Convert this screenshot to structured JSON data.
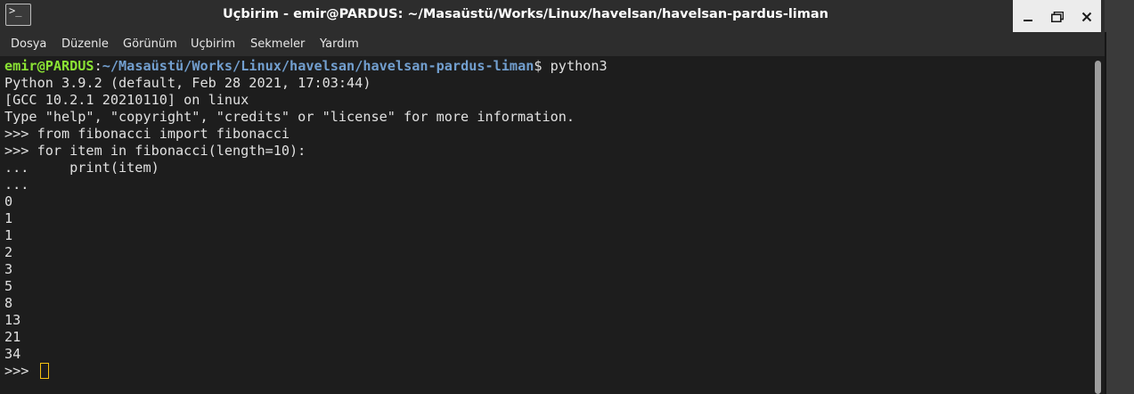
{
  "window": {
    "title": "Uçbirim - emir@PARDUS: ~/Masaüstü/Works/Linux/havelsan/havelsan-pardus-liman",
    "app_icon_glyph": ">_",
    "controls": {
      "minimize": "–",
      "maximize": "❐",
      "close": "✕"
    }
  },
  "menubar": {
    "items": [
      "Dosya",
      "Düzenle",
      "Görünüm",
      "Uçbirim",
      "Sekmeler",
      "Yardım"
    ]
  },
  "terminal": {
    "prompt_user": "emir@PARDUS",
    "prompt_sep": ":",
    "prompt_path": "~/Masaüstü/Works/Linux/havelsan/havelsan-pardus-liman",
    "prompt_command": "$ python3",
    "lines": [
      "Python 3.9.2 (default, Feb 28 2021, 17:03:44)",
      "[GCC 10.2.1 20210110] on linux",
      "Type \"help\", \"copyright\", \"credits\" or \"license\" for more information.",
      ">>> from fibonacci import fibonacci",
      ">>> for item in fibonacci(length=10):",
      "...     print(item)",
      "...",
      "0",
      "1",
      "1",
      "2",
      "3",
      "5",
      "8",
      "13",
      "21",
      "34"
    ],
    "final_prompt": ">>> "
  },
  "colors": {
    "background": "#1d1d1d",
    "text": "#e0e0e0",
    "prompt_user": "#8ae234",
    "prompt_path": "#729fcf",
    "cursor": "#f5c211"
  }
}
